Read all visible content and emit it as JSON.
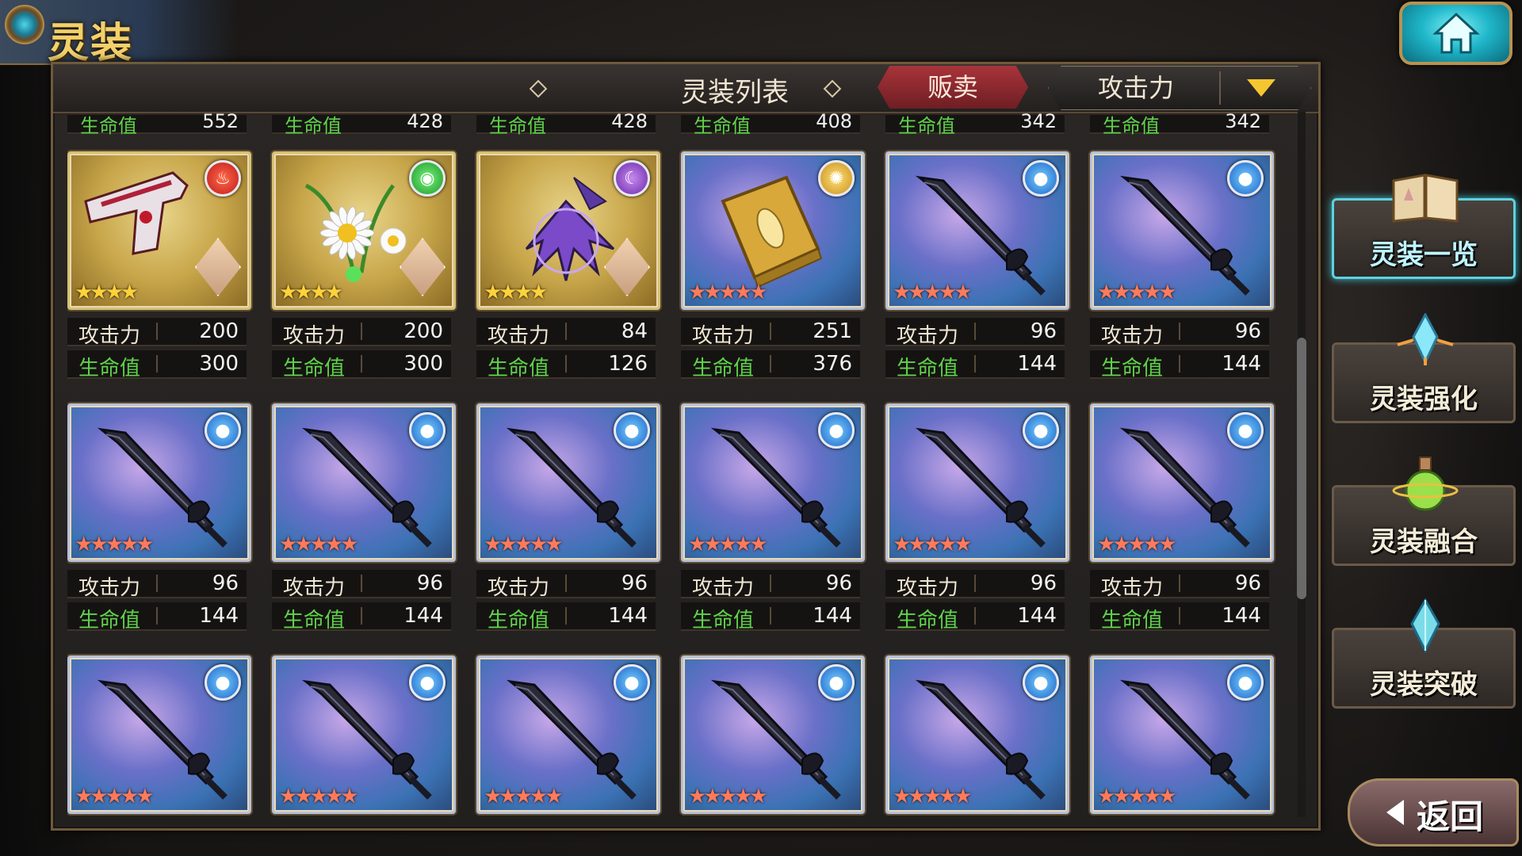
{
  "screen_title": "灵装",
  "header": {
    "title": "灵装列表",
    "sell_label": "贩卖",
    "sort_label": "攻击力"
  },
  "labels": {
    "attack": "攻击力",
    "hp": "生命值"
  },
  "partial_row": [
    {
      "hp": "552"
    },
    {
      "hp": "428"
    },
    {
      "hp": "428"
    },
    {
      "hp": "408"
    },
    {
      "hp": "342"
    },
    {
      "hp": "342"
    }
  ],
  "cards": [
    {
      "kind": "gun",
      "frame": "gold",
      "attribute": "fire",
      "stars": "★★★★",
      "star_count": 4,
      "attack": "200",
      "hp": "300",
      "has_character": true
    },
    {
      "kind": "daisy",
      "frame": "gold",
      "attribute": "wind",
      "stars": "★★★★",
      "star_count": 4,
      "attack": "200",
      "hp": "300",
      "has_character": true
    },
    {
      "kind": "wings",
      "frame": "gold",
      "attribute": "dark",
      "stars": "★★★★",
      "star_count": 4,
      "attack": "84",
      "hp": "126",
      "has_character": true
    },
    {
      "kind": "book",
      "frame": "blue",
      "attribute": "light",
      "stars": "★★★★★",
      "star_count": 5,
      "attack": "251",
      "hp": "376",
      "has_character": false
    },
    {
      "kind": "sword",
      "frame": "blue",
      "attribute": "water",
      "stars": "★★★★★",
      "star_count": 5,
      "attack": "96",
      "hp": "144",
      "has_character": false
    },
    {
      "kind": "sword",
      "frame": "blue",
      "attribute": "water",
      "stars": "★★★★★",
      "star_count": 5,
      "attack": "96",
      "hp": "144",
      "has_character": false
    },
    {
      "kind": "sword",
      "frame": "blue",
      "attribute": "water",
      "stars": "★★★★★",
      "star_count": 5,
      "attack": "96",
      "hp": "144",
      "has_character": false
    },
    {
      "kind": "sword",
      "frame": "blue",
      "attribute": "water",
      "stars": "★★★★★",
      "star_count": 5,
      "attack": "96",
      "hp": "144",
      "has_character": false
    },
    {
      "kind": "sword",
      "frame": "blue",
      "attribute": "water",
      "stars": "★★★★★",
      "star_count": 5,
      "attack": "96",
      "hp": "144",
      "has_character": false
    },
    {
      "kind": "sword",
      "frame": "blue",
      "attribute": "water",
      "stars": "★★★★★",
      "star_count": 5,
      "attack": "96",
      "hp": "144",
      "has_character": false
    },
    {
      "kind": "sword",
      "frame": "blue",
      "attribute": "water",
      "stars": "★★★★★",
      "star_count": 5,
      "attack": "96",
      "hp": "144",
      "has_character": false
    },
    {
      "kind": "sword",
      "frame": "blue",
      "attribute": "water",
      "stars": "★★★★★",
      "star_count": 5,
      "attack": "96",
      "hp": "144",
      "has_character": false
    },
    {
      "kind": "sword",
      "frame": "blue",
      "attribute": "water",
      "stars": "★★★★★",
      "star_count": 5,
      "has_character": false
    },
    {
      "kind": "sword",
      "frame": "blue",
      "attribute": "water",
      "stars": "★★★★★",
      "star_count": 5,
      "has_character": false
    },
    {
      "kind": "sword",
      "frame": "blue",
      "attribute": "water",
      "stars": "★★★★★",
      "star_count": 5,
      "has_character": false
    },
    {
      "kind": "sword",
      "frame": "blue",
      "attribute": "water",
      "stars": "★★★★★",
      "star_count": 5,
      "has_character": false
    },
    {
      "kind": "sword",
      "frame": "blue",
      "attribute": "water",
      "stars": "★★★★★",
      "star_count": 5,
      "has_character": false
    },
    {
      "kind": "sword",
      "frame": "blue",
      "attribute": "water",
      "stars": "★★★★★",
      "star_count": 5,
      "has_character": false
    }
  ],
  "side_menu": [
    {
      "id": "list",
      "label": "灵装一览",
      "icon": "open-book-icon",
      "active": true
    },
    {
      "id": "enhance",
      "label": "灵装强化",
      "icon": "crystal-burst-icon",
      "active": false
    },
    {
      "id": "fusion",
      "label": "灵装融合",
      "icon": "potion-flask-icon",
      "active": false
    },
    {
      "id": "breakthrough",
      "label": "灵装突破",
      "icon": "crystal-shard-icon",
      "active": false
    }
  ],
  "back_label": "返回",
  "colors": {
    "accent_cyan": "#5ed2e0",
    "sell_red": "#a8343a",
    "hp_green": "#5fd24a",
    "star_gold": "#ffd23a",
    "star_rainbow": "#ff7a5a"
  }
}
